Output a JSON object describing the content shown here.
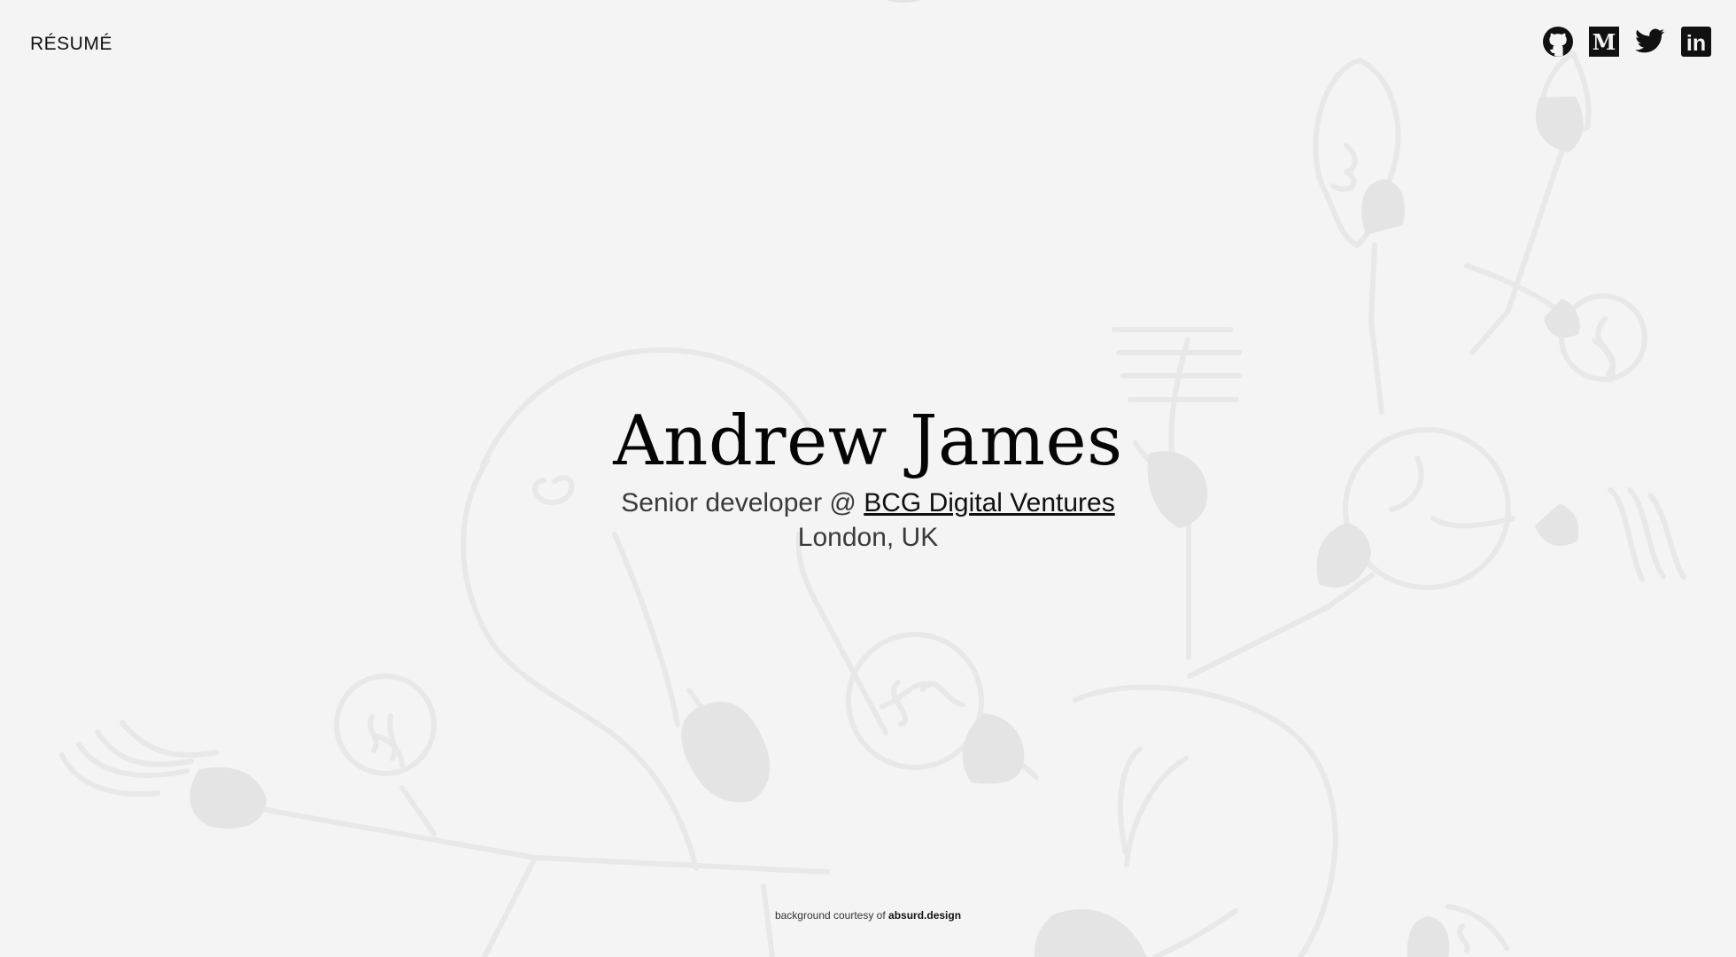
{
  "header": {
    "resume_label": "RÉSUMÉ"
  },
  "social": {
    "github_icon": "github-icon",
    "medium_icon": "medium-icon",
    "twitter_icon": "twitter-icon",
    "linkedin_icon": "linkedin-icon",
    "medium_letter": "M",
    "linkedin_text": "in"
  },
  "hero": {
    "name": "Andrew James",
    "role_prefix": "Senior developer @ ",
    "company": "BCG Digital Ventures",
    "location": "London, UK"
  },
  "footer": {
    "credit_prefix": "background courtesy of ",
    "credit_link": "absurd.design"
  },
  "colors": {
    "background": "#f4f4f4",
    "text": "#111111",
    "muted_text": "#3a3a3a",
    "illustration": "#e6e6e6"
  }
}
